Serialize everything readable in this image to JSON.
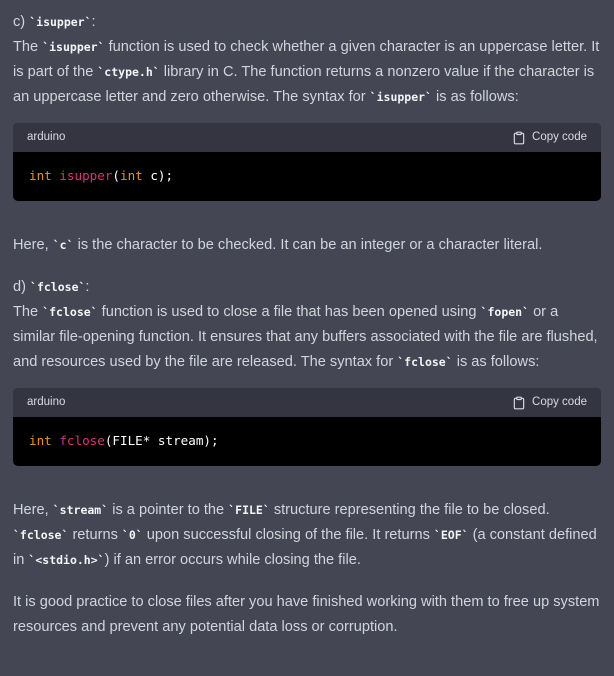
{
  "section_c": {
    "heading_prefix": "c) ",
    "heading_code": "`isupper`",
    "heading_suffix": ":",
    "p1": [
      {
        "t": "text",
        "v": "The "
      },
      {
        "t": "code",
        "v": "`isupper`"
      },
      {
        "t": "text",
        "v": " function is used to check whether a given character is an uppercase letter. It is part of the "
      },
      {
        "t": "code",
        "v": "`ctype.h`"
      },
      {
        "t": "text",
        "v": " library in C. The function returns a nonzero value if the character is an uppercase letter and zero otherwise. The syntax for "
      },
      {
        "t": "code",
        "v": "`isupper`"
      },
      {
        "t": "text",
        "v": " is as follows:"
      }
    ],
    "code": {
      "language": "arduino",
      "copy_label": "Copy code",
      "tokens": [
        {
          "c": "kw2",
          "v": "int"
        },
        {
          "c": "",
          "v": " "
        },
        {
          "c": "fn",
          "v": "isupper"
        },
        {
          "c": "",
          "v": "("
        },
        {
          "c": "kw2",
          "v": "int"
        },
        {
          "c": "",
          "v": " c);"
        }
      ]
    },
    "p2": [
      {
        "t": "text",
        "v": "Here, "
      },
      {
        "t": "code",
        "v": "`c`"
      },
      {
        "t": "text",
        "v": " is the character to be checked. It can be an integer or a character literal."
      }
    ]
  },
  "section_d": {
    "heading_prefix": "d) ",
    "heading_code": "`fclose`",
    "heading_suffix": ":",
    "p1": [
      {
        "t": "text",
        "v": "The "
      },
      {
        "t": "code",
        "v": "`fclose`"
      },
      {
        "t": "text",
        "v": " function is used to close a file that has been opened using "
      },
      {
        "t": "code",
        "v": "`fopen`"
      },
      {
        "t": "text",
        "v": " or a similar file-opening function. It ensures that any buffers associated with the file are flushed, and resources used by the file are released. The syntax for "
      },
      {
        "t": "code",
        "v": "`fclose`"
      },
      {
        "t": "text",
        "v": " is as follows:"
      }
    ],
    "code": {
      "language": "arduino",
      "copy_label": "Copy code",
      "tokens": [
        {
          "c": "kw2",
          "v": "int"
        },
        {
          "c": "",
          "v": " "
        },
        {
          "c": "fn",
          "v": "fclose"
        },
        {
          "c": "",
          "v": "(FILE* stream);"
        }
      ]
    },
    "p2": [
      {
        "t": "text",
        "v": "Here, "
      },
      {
        "t": "code",
        "v": "`stream`"
      },
      {
        "t": "text",
        "v": " is a pointer to the "
      },
      {
        "t": "code",
        "v": "`FILE`"
      },
      {
        "t": "text",
        "v": " structure representing the file to be closed. "
      },
      {
        "t": "code",
        "v": "`fclose`"
      },
      {
        "t": "text",
        "v": " returns "
      },
      {
        "t": "code",
        "v": "`0`"
      },
      {
        "t": "text",
        "v": " upon successful closing of the file. It returns "
      },
      {
        "t": "code",
        "v": "`EOF`"
      },
      {
        "t": "text",
        "v": " (a constant defined in "
      },
      {
        "t": "code",
        "v": "`<stdio.h>`"
      },
      {
        "t": "text",
        "v": ") if an error occurs while closing the file."
      }
    ],
    "p3": "It is good practice to close files after you have finished working with them to free up system resources and prevent any potential data loss or corruption."
  },
  "colors": {
    "background": "#444654",
    "text": "#d1d5db",
    "code_header": "#343541",
    "code_body": "#000000",
    "keyword": "#e9950c",
    "function": "#df3079"
  },
  "icons": {
    "copy": "clipboard-icon"
  }
}
